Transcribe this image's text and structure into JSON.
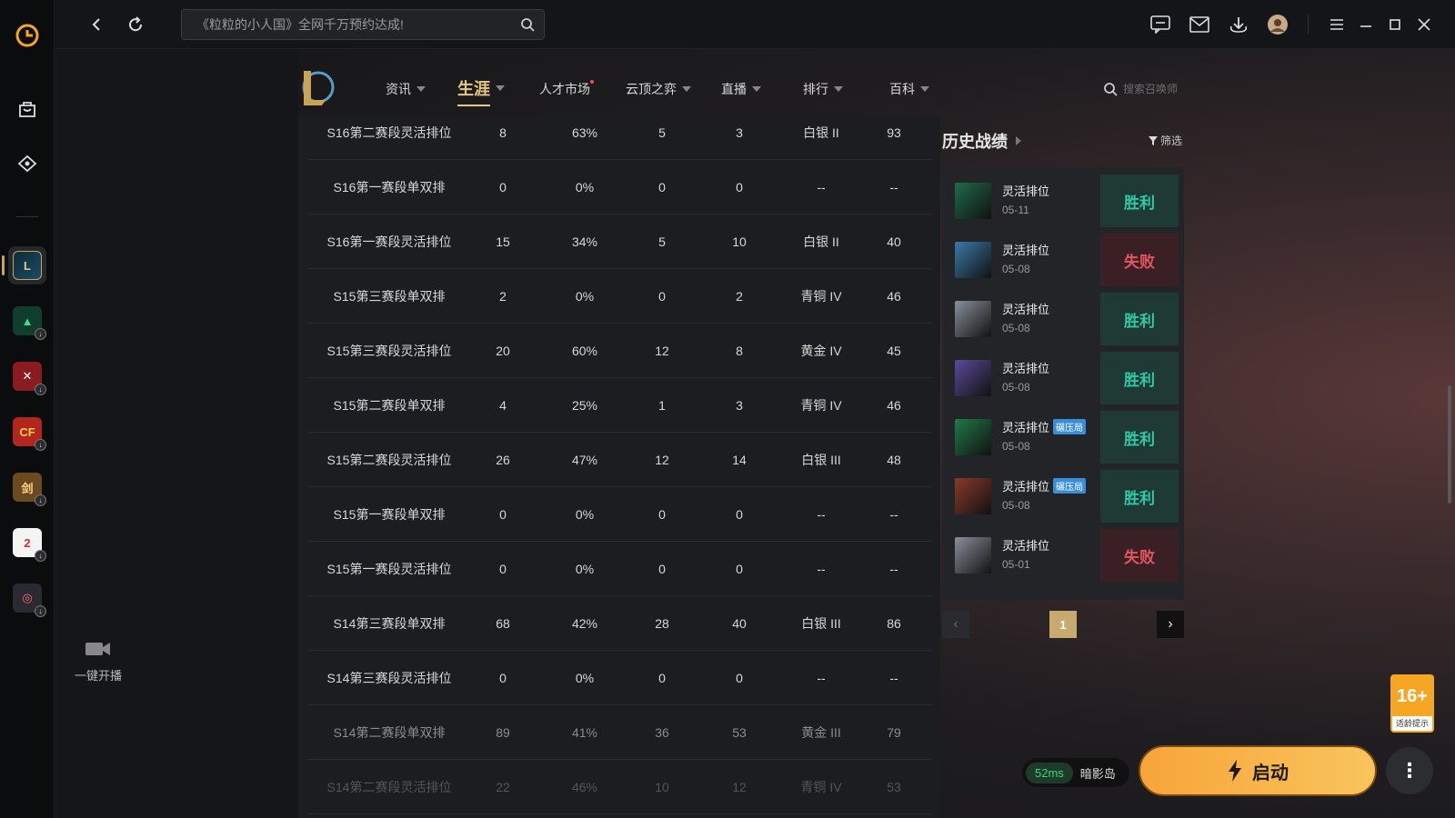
{
  "app": {
    "search_placeholder": "《粒粒的小人国》全网千万预约达成!"
  },
  "nav": {
    "items": [
      {
        "label": "资讯",
        "caret": true
      },
      {
        "label": "生涯",
        "caret": true,
        "active": true
      },
      {
        "label": "人才市场",
        "caret": false,
        "dot": true
      },
      {
        "label": "云顶之弈",
        "caret": true
      },
      {
        "label": "直播",
        "caret": true
      },
      {
        "label": "排行",
        "caret": true
      },
      {
        "label": "百科",
        "caret": true
      }
    ],
    "summoner_search_placeholder": "搜索召唤师"
  },
  "sidebar": {
    "stream_label": "一键开播"
  },
  "career_table": {
    "rows": [
      [
        "S16第二赛段灵活排位",
        "8",
        "63%",
        "5",
        "3",
        "白银 II",
        "93"
      ],
      [
        "S16第一赛段单双排",
        "0",
        "0%",
        "0",
        "0",
        "--",
        "--"
      ],
      [
        "S16第一赛段灵活排位",
        "15",
        "34%",
        "5",
        "10",
        "白银 II",
        "40"
      ],
      [
        "S15第三赛段单双排",
        "2",
        "0%",
        "0",
        "2",
        "青铜 IV",
        "46"
      ],
      [
        "S15第三赛段灵活排位",
        "20",
        "60%",
        "12",
        "8",
        "黄金 IV",
        "45"
      ],
      [
        "S15第二赛段单双排",
        "4",
        "25%",
        "1",
        "3",
        "青铜 IV",
        "46"
      ],
      [
        "S15第二赛段灵活排位",
        "26",
        "47%",
        "12",
        "14",
        "白银 III",
        "48"
      ],
      [
        "S15第一赛段单双排",
        "0",
        "0%",
        "0",
        "0",
        "--",
        "--"
      ],
      [
        "S15第一赛段灵活排位",
        "0",
        "0%",
        "0",
        "0",
        "--",
        "--"
      ],
      [
        "S14第三赛段单双排",
        "68",
        "42%",
        "28",
        "40",
        "白银 III",
        "86"
      ],
      [
        "S14第三赛段灵活排位",
        "0",
        "0%",
        "0",
        "0",
        "--",
        "--"
      ],
      [
        "S14第二赛段单双排",
        "89",
        "41%",
        "36",
        "53",
        "黄金 III",
        "79"
      ],
      [
        "S14第二赛段灵活排位",
        "22",
        "46%",
        "10",
        "12",
        "青铜 IV",
        "53"
      ]
    ]
  },
  "history": {
    "title": "历史战绩",
    "filter_label": "筛选",
    "matches": [
      {
        "mode": "灵活排位",
        "tag": "",
        "date": "05-11",
        "result": "胜利",
        "win": true,
        "color": "#1f6b4a"
      },
      {
        "mode": "灵活排位",
        "tag": "",
        "date": "05-08",
        "result": "失败",
        "win": false,
        "color": "#3a7aa8"
      },
      {
        "mode": "灵活排位",
        "tag": "",
        "date": "05-08",
        "result": "胜利",
        "win": true,
        "color": "#8a8f9a"
      },
      {
        "mode": "灵活排位",
        "tag": "",
        "date": "05-08",
        "result": "胜利",
        "win": true,
        "color": "#5a4a9a"
      },
      {
        "mode": "灵活排位",
        "tag": "碾压局",
        "date": "05-08",
        "result": "胜利",
        "win": true,
        "color": "#1f7a4a"
      },
      {
        "mode": "灵活排位",
        "tag": "碾压局",
        "date": "05-08",
        "result": "胜利",
        "win": true,
        "color": "#8a3a2a"
      },
      {
        "mode": "灵活排位",
        "tag": "",
        "date": "05-01",
        "result": "失败",
        "win": false,
        "color": "#8a8f9a"
      }
    ],
    "page": "1"
  },
  "footer": {
    "ping": "52ms",
    "server": "暗影岛",
    "launch_label": "启动",
    "cadpa_age": "16+",
    "cadpa_note": "适龄提示"
  }
}
